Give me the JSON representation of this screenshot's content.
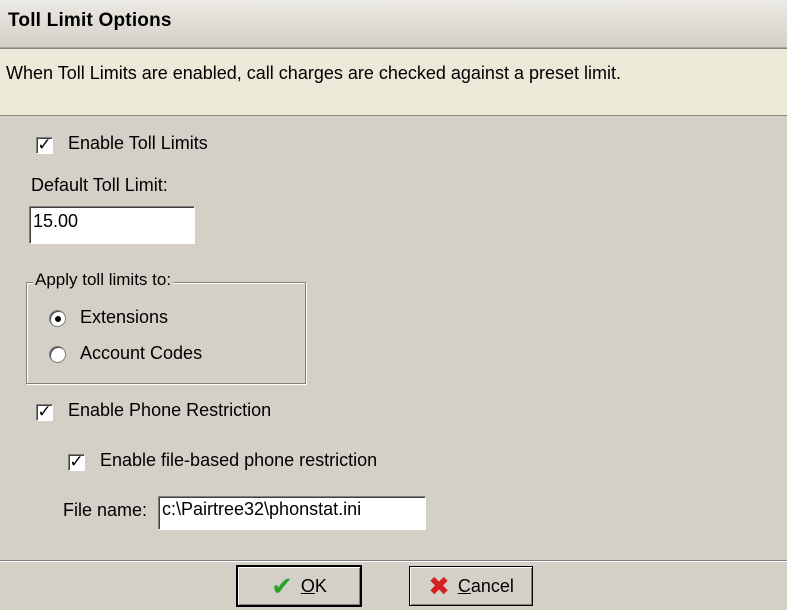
{
  "window": {
    "title": "Toll Limit Options",
    "description": "When Toll Limits are enabled, call charges are checked against a preset limit."
  },
  "toll": {
    "enable_label": "Enable Toll Limits",
    "enable_checked": true,
    "default_label": "Default Toll Limit:",
    "default_value": "15.00"
  },
  "apply_group": {
    "legend": "Apply toll limits to:",
    "options": [
      {
        "label": "Extensions",
        "selected": true
      },
      {
        "label": "Account Codes",
        "selected": false
      }
    ]
  },
  "phone": {
    "enable_label": "Enable Phone Restriction",
    "enable_checked": true,
    "file_based_label": "Enable file-based phone restriction",
    "file_based_checked": true,
    "file_name_label": "File name:",
    "file_name_value": "c:\\Pairtree32\\phonstat.ini"
  },
  "buttons": {
    "ok_hotkey": "O",
    "ok_rest": "K",
    "cancel_hotkey": "C",
    "cancel_rest": "ancel"
  },
  "icons": {
    "ok": "check-icon",
    "cancel": "x-icon"
  },
  "colors": {
    "ok_icon": "#2aa12a",
    "cancel_icon": "#d42222",
    "dialog_bg": "#d4d0c8"
  }
}
